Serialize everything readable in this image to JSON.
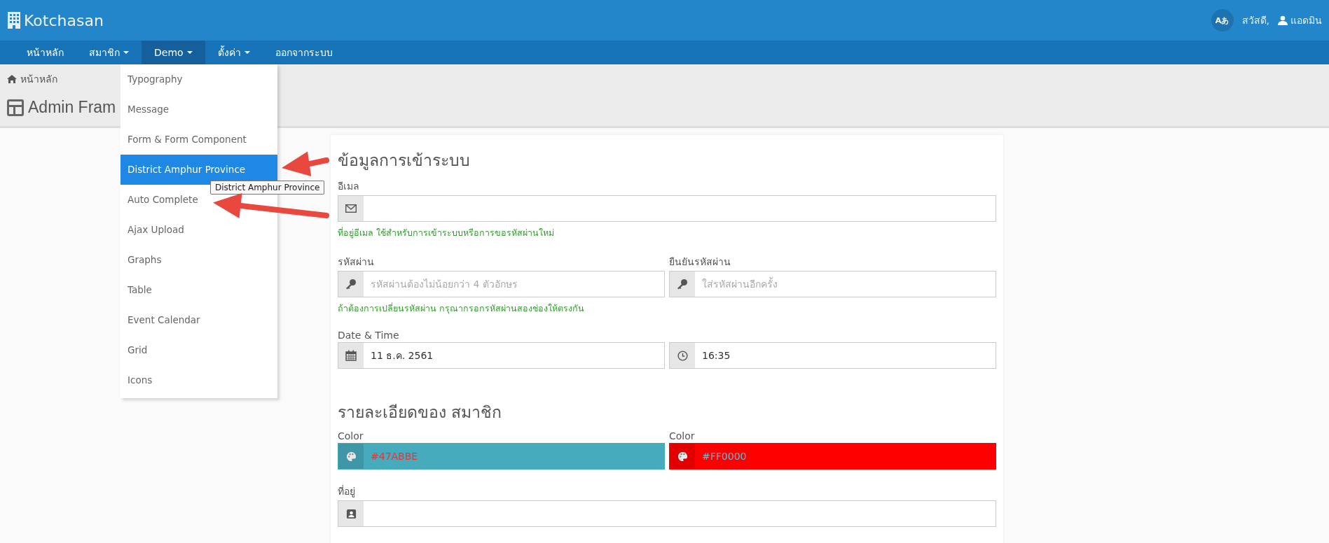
{
  "header": {
    "brand": "Kotchasan",
    "language_button": "Aあ",
    "greeting": "สวัสดี,",
    "user": "แอดมิน"
  },
  "nav": [
    {
      "label": "หน้าหลัก",
      "caret": false,
      "selected": false
    },
    {
      "label": "สมาชิก",
      "caret": true,
      "selected": false
    },
    {
      "label": "Demo",
      "caret": true,
      "selected": true
    },
    {
      "label": "ตั้งค่า",
      "caret": true,
      "selected": false
    },
    {
      "label": "ออกจากระบบ",
      "caret": false,
      "selected": false
    }
  ],
  "dropdown": [
    {
      "label": "Typography",
      "selected": false
    },
    {
      "label": "Message",
      "selected": false
    },
    {
      "label": "Form & Form Component",
      "selected": false
    },
    {
      "label": "District Amphur Province",
      "selected": true
    },
    {
      "label": "Auto Complete",
      "selected": false
    },
    {
      "label": "Ajax Upload",
      "selected": false
    },
    {
      "label": "Graphs",
      "selected": false
    },
    {
      "label": "Table",
      "selected": false
    },
    {
      "label": "Event Calendar",
      "selected": false
    },
    {
      "label": "Grid",
      "selected": false
    },
    {
      "label": "Icons",
      "selected": false
    }
  ],
  "tooltip": "District Amphur Province",
  "breadcrumb": "หน้าหลัก",
  "page_title": "Admin Fram",
  "sections": [
    {
      "title": "ข้อมูลการเข้าระบบ",
      "rows": [
        {
          "fields": [
            {
              "label": "อีเมล",
              "kind": "email"
            }
          ],
          "hint": "ที่อยู่อีเมล ใช้สำหรับการเข้าระบบหรือการขอรหัสผ่านใหม่"
        },
        {
          "fields": [
            {
              "label": "รหัสผ่าน",
              "kind": "key",
              "placeholder": "รหัสผ่านต้องไม่น้อยกว่า 4 ตัวอักษร"
            },
            {
              "label": "ยืนยันรหัสผ่าน",
              "kind": "key",
              "placeholder": "ใส่รหัสผ่านอีกครั้ง"
            }
          ],
          "hint": "ถ้าต้องการเปลี่ยนรหัสผ่าน กรุณากรอกรหัสผ่านสองช่องให้ตรงกัน"
        },
        {
          "label": "Date & Time",
          "fields": [
            {
              "kind": "calendar",
              "value": "11 ธ.ค. 2561"
            },
            {
              "kind": "clock",
              "value": "16:35"
            }
          ]
        }
      ]
    },
    {
      "title": "รายละเอียดของ สมาชิก",
      "rows": [
        {
          "fields": [
            {
              "label": "Color",
              "kind": "palette",
              "value": "#47ABBE",
              "color": "#47abbe"
            },
            {
              "label": "Color",
              "kind": "palette",
              "value": "#FF0000",
              "color": "#ff0000"
            }
          ]
        },
        {
          "fields": [
            {
              "label": "ที่อยู่",
              "kind": "contact"
            }
          ]
        }
      ]
    }
  ]
}
